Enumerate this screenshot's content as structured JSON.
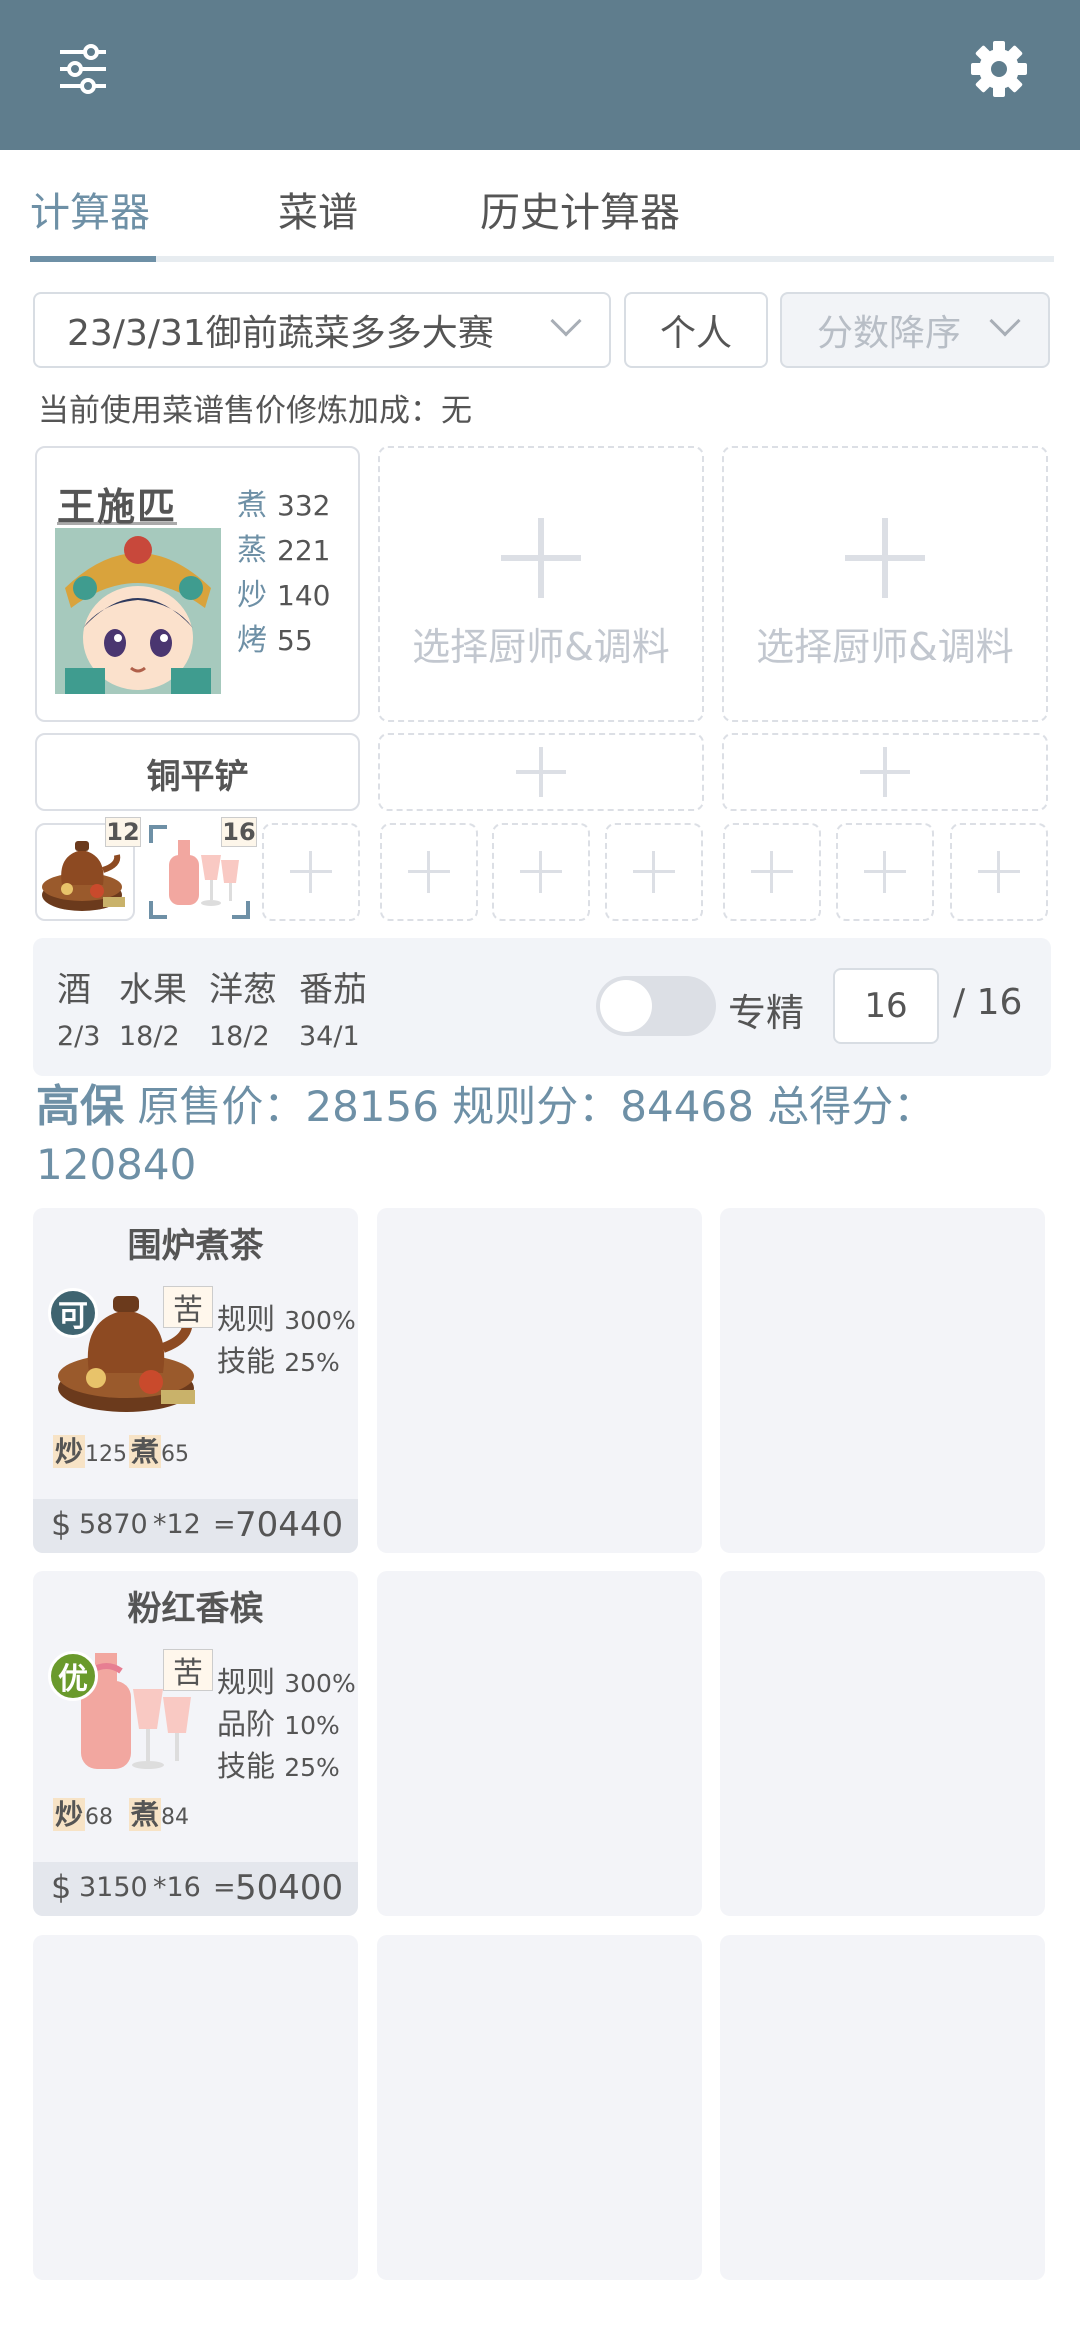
{
  "tabs": [
    {
      "label": "计算器",
      "active": true
    },
    {
      "label": "菜谱"
    },
    {
      "label": "历史计算器"
    }
  ],
  "filters": {
    "event": "23/3/31御前蔬菜多多大赛",
    "mode": "个人",
    "sort": "分数降序"
  },
  "note": "当前使用菜谱售价修炼加成：无",
  "chef": {
    "name": "王施匹",
    "stats": [
      {
        "k": "煮",
        "v": "332"
      },
      {
        "k": "蒸",
        "v": "221"
      },
      {
        "k": "炒",
        "v": "140"
      },
      {
        "k": "烤",
        "v": "55"
      }
    ]
  },
  "empty_chef_label": "选择厨师&调料",
  "equipment": "铜平铲",
  "recipe_thumbs": [
    {
      "count": "12"
    },
    {
      "count": "16"
    }
  ],
  "ingredients": [
    {
      "name": "酒",
      "count": "2/3"
    },
    {
      "name": "水果",
      "count": "18/2"
    },
    {
      "name": "洋葱",
      "count": "18/2"
    },
    {
      "name": "番茄",
      "count": "34/1"
    }
  ],
  "spec_label": "专精",
  "spec_value": "16",
  "spec_total": "/ 16",
  "summary": {
    "grade": "高保",
    "text": " 原售价：28156 规则分：84468 总得分：120840"
  },
  "dishes": [
    {
      "name": "围炉煮茶",
      "rank": "可",
      "rank_color": "#3f6470",
      "taste": "苦",
      "bonuses": [
        {
          "k": "规则",
          "v": "300%"
        },
        {
          "k": "技能",
          "v": "25%"
        }
      ],
      "skills": [
        {
          "t": "炒",
          "v": "125"
        },
        {
          "t": "煮",
          "v": "65"
        }
      ],
      "price": "5870",
      "qty": "*12",
      "eq": "=",
      "total": "70440"
    },
    {
      "name": "粉红香槟",
      "rank": "优",
      "rank_color": "#6a9a2c",
      "taste": "苦",
      "bonuses": [
        {
          "k": "规则",
          "v": "300%"
        },
        {
          "k": "品阶",
          "v": "10%"
        },
        {
          "k": "技能",
          "v": "25%"
        }
      ],
      "skills": [
        {
          "t": "炒",
          "v": "68"
        },
        {
          "t": "煮",
          "v": "84"
        }
      ],
      "price": "3150",
      "qty": "*16",
      "eq": "=",
      "total": "50400"
    }
  ],
  "currency": "$",
  "colors": {
    "header": "#5f7d8d",
    "accent": "#6e90a6",
    "panel": "#f2f4f8"
  }
}
